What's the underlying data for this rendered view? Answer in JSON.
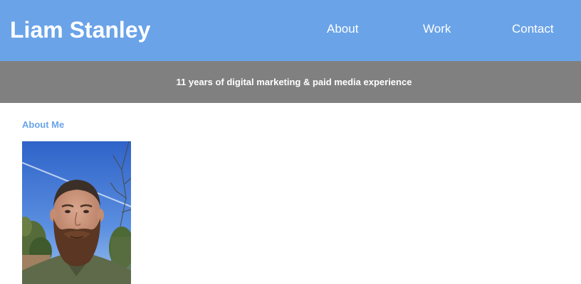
{
  "header": {
    "brand": "Liam Stanley",
    "nav": [
      {
        "label": "About"
      },
      {
        "label": "Work"
      },
      {
        "label": "Contact"
      }
    ]
  },
  "banner": {
    "tagline": "11 years of digital marketing & paid media experience"
  },
  "about": {
    "heading": "About Me"
  },
  "colors": {
    "header_bg": "#6aa3e8",
    "banner_bg": "#808080",
    "accent": "#6aa3e8",
    "text_light": "#ffffff"
  }
}
